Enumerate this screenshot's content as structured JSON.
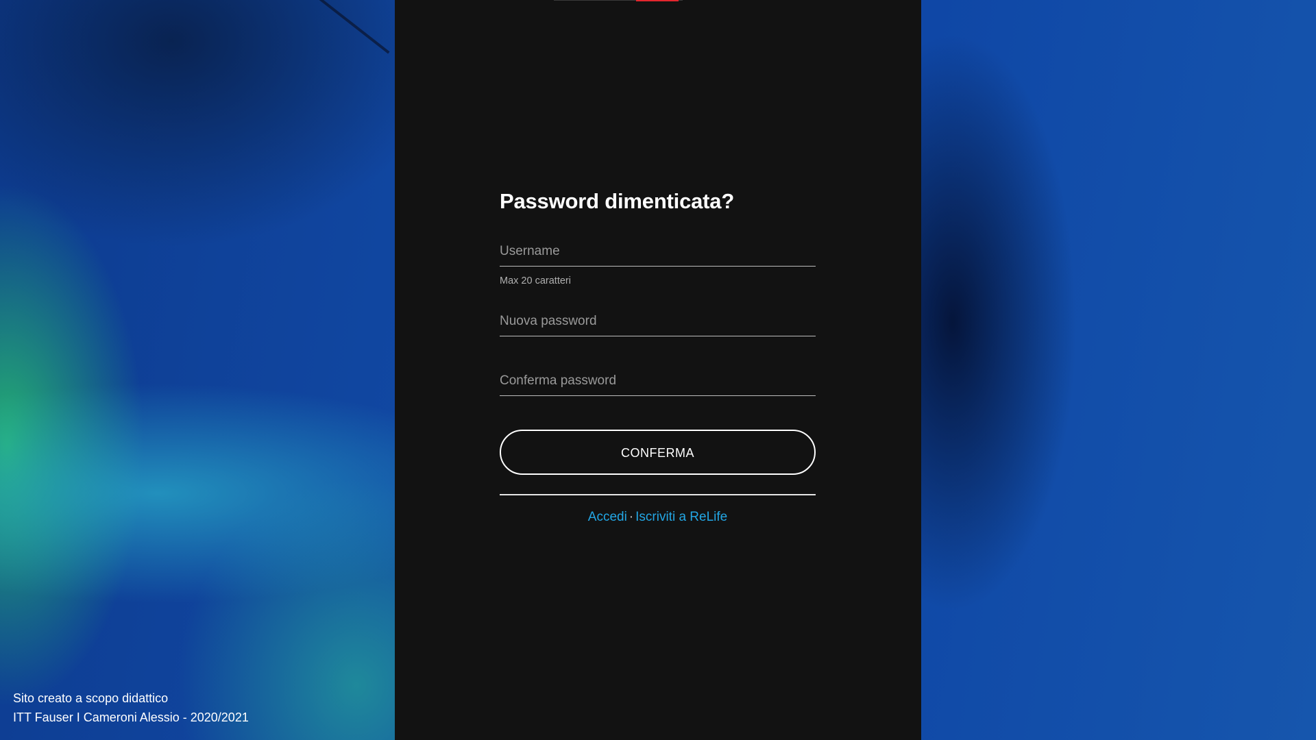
{
  "form": {
    "title": "Password dimenticata?",
    "username_placeholder": "Username",
    "username_hint": "Max 20 caratteri",
    "new_password_placeholder": "Nuova password",
    "confirm_password_placeholder": "Conferma password",
    "submit_label": "CONFERMA"
  },
  "links": {
    "login_label": "Accedi",
    "separator": "·",
    "signup_label": "Iscriviti a ReLife"
  },
  "footer": {
    "line1": "Sito creato a scopo didattico",
    "line2": "ITT Fauser I Cameroni Alessio - 2020/2021"
  },
  "colors": {
    "panel": "#121212",
    "link": "#23a7e5",
    "accent": "#e3262e",
    "background": "#1148a3"
  }
}
